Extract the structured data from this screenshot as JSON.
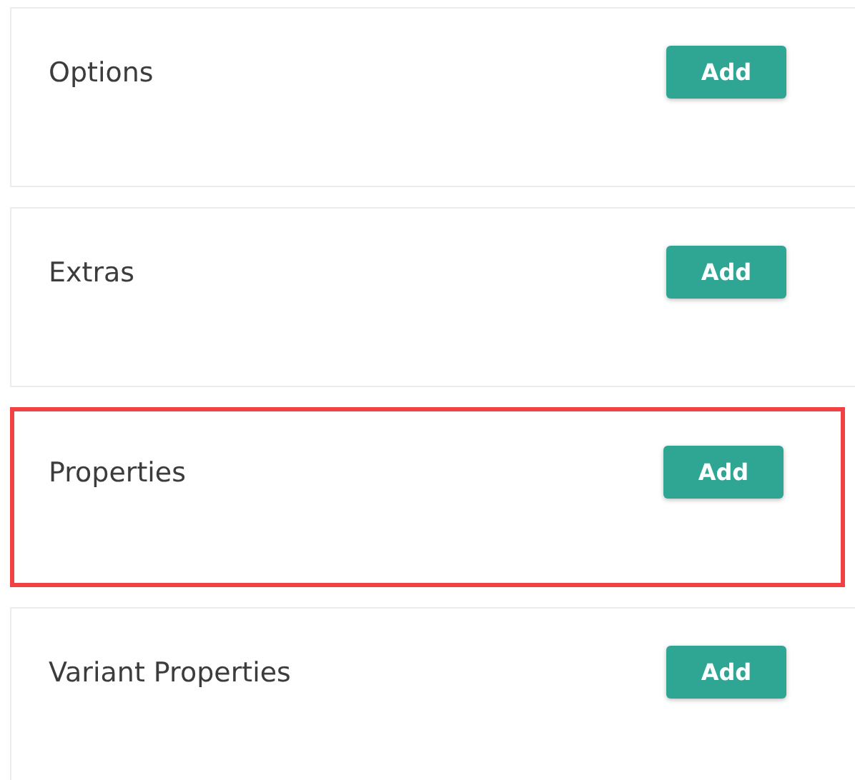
{
  "sections": [
    {
      "title": "Options",
      "button": "Add",
      "highlighted": false
    },
    {
      "title": "Extras",
      "button": "Add",
      "highlighted": false
    },
    {
      "title": "Properties",
      "button": "Add",
      "highlighted": true
    },
    {
      "title": "Variant Properties",
      "button": "Add",
      "highlighted": false
    }
  ]
}
